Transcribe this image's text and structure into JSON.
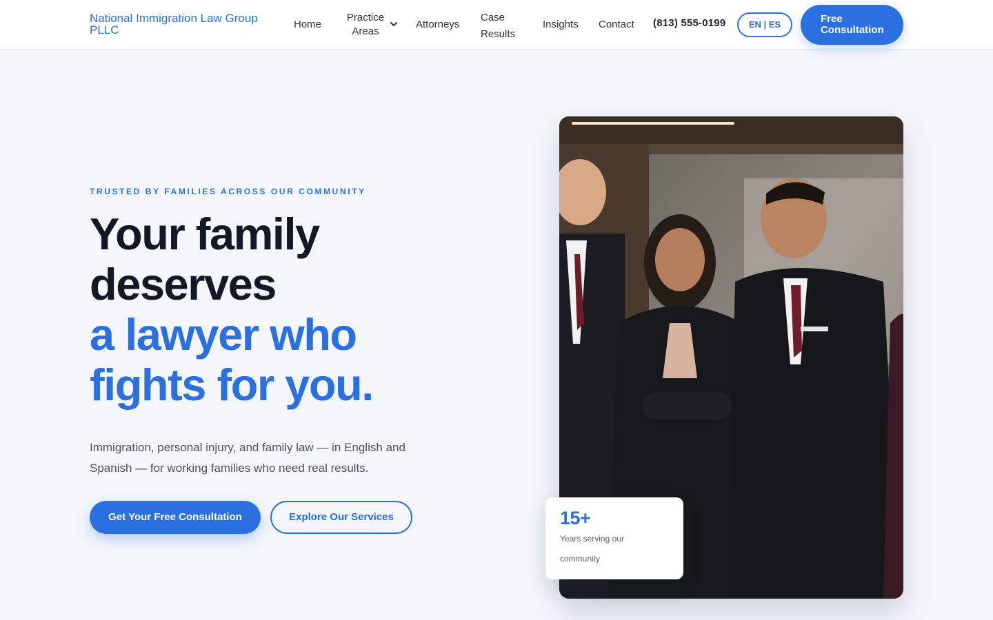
{
  "header": {
    "logo": "National Immigration Law Group PLLC",
    "nav": {
      "home": "Home",
      "practice_areas": "Practice Areas",
      "attorneys": "Attorneys",
      "case_results": "Case Results",
      "insights": "Insights",
      "contact": "Contact"
    },
    "phone": "(813) 555-0199",
    "language_toggle": "EN | ES",
    "cta": "Free Consultation"
  },
  "hero": {
    "eyebrow": "TRUSTED BY FAMILIES ACROSS OUR COMMUNITY",
    "headline_line1": "Your family",
    "headline_line2": "deserves",
    "headline_line3": "a lawyer who",
    "headline_line4": "fights for you.",
    "subtext": "Immigration, personal injury, and family law — in English and Spanish — for working families who need real results.",
    "primary_button": "Get Your Free Consultation",
    "secondary_button": "Explore Our Services",
    "stat": {
      "value": "15+",
      "label": "Years serving our community"
    }
  },
  "colors": {
    "accent": "#2a70e0",
    "heading": "#121826",
    "background": "#f4f6fb"
  },
  "icons": {
    "practice_dropdown": "chevron-down-icon"
  }
}
